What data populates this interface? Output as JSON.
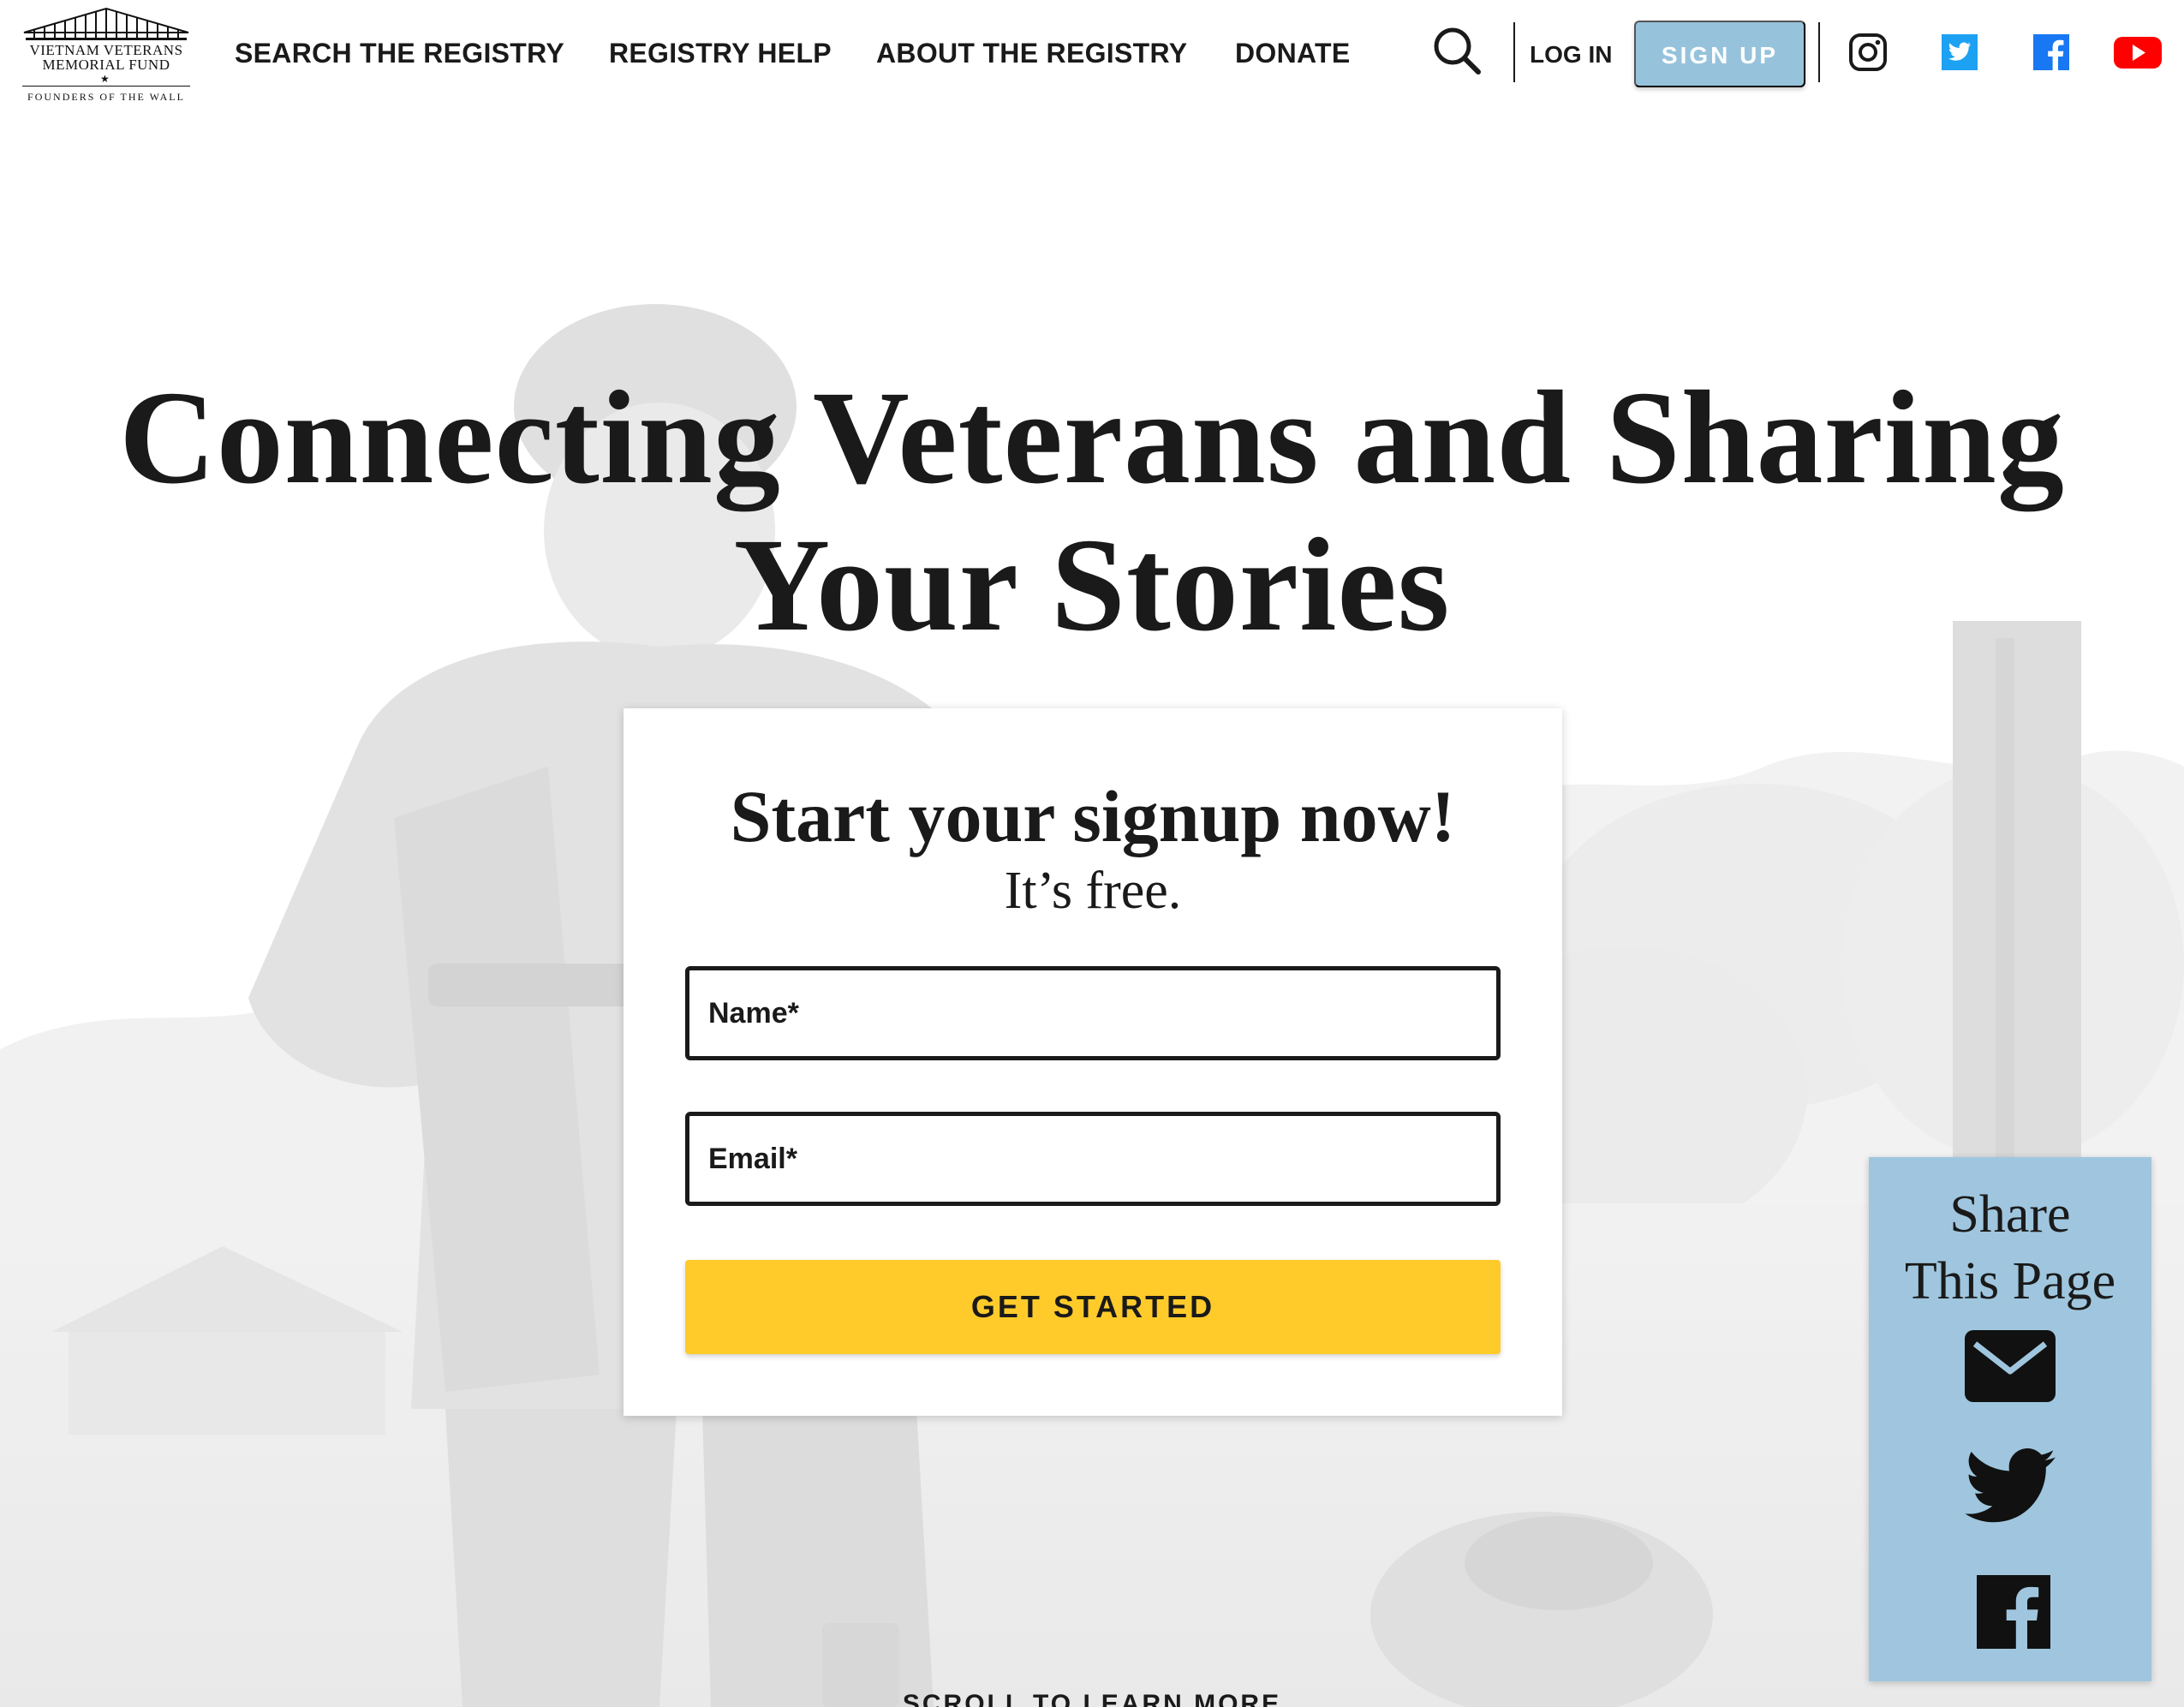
{
  "logo": {
    "line1": "VIETNAM VETERANS",
    "line2": "MEMORIAL FUND",
    "star": "★",
    "tagline": "FOUNDERS OF THE WALL"
  },
  "nav": {
    "items": [
      {
        "label": "SEARCH THE REGISTRY"
      },
      {
        "label": "REGISTRY HELP"
      },
      {
        "label": "ABOUT THE REGISTRY"
      },
      {
        "label": "DONATE"
      }
    ],
    "search_icon": "search-icon",
    "login_label": "LOG IN",
    "signup_label": "SIGN UP",
    "social": [
      "instagram-icon",
      "twitter-icon",
      "facebook-icon",
      "youtube-icon"
    ]
  },
  "hero": {
    "headline_line1": "Connecting Veterans and Sharing",
    "headline_line2": "Your Stories",
    "scroll_label": "SCROLL TO LEARN MORE"
  },
  "signup_card": {
    "title": "Start your signup now!",
    "subtitle": "It’s free.",
    "name_placeholder": "Name*",
    "email_placeholder": "Email*",
    "button_label": "GET STARTED"
  },
  "share_panel": {
    "title_line1": "Share",
    "title_line2": "This Page",
    "icons": [
      "email-icon",
      "twitter-icon",
      "facebook-icon"
    ]
  },
  "colors": {
    "accent_yellow": "#ffcb2b",
    "signup_blue": "#97c2dc",
    "share_blue": "#9fc6de",
    "text_dark": "#1a1a1a",
    "twitter_blue": "#1da1f2",
    "facebook_blue": "#1877f2",
    "youtube_red": "#ff0000"
  }
}
